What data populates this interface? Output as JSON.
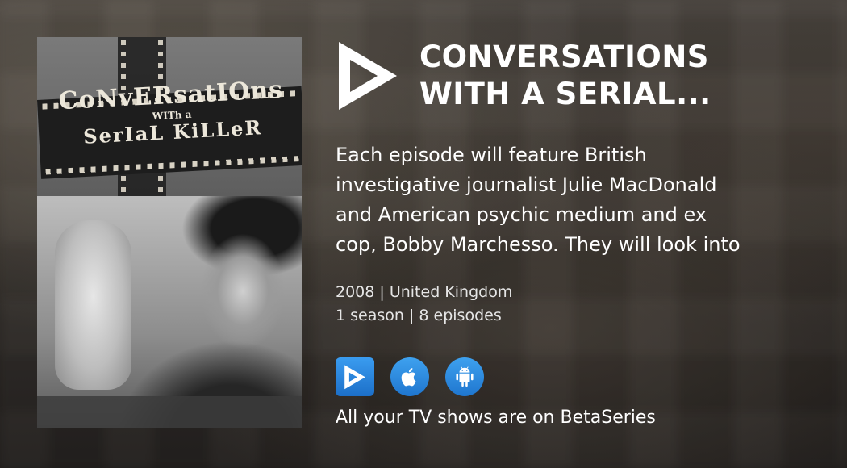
{
  "show": {
    "title_line1": "CONVERSATIONS",
    "title_line2": "WITH A SERIAL...",
    "description_lines": [
      "Each episode will feature British",
      "investigative journalist Julie MacDonald",
      "and American psychic medium and ex",
      "cop, Bobby Marchesso. They will look into"
    ],
    "year_country": "2008 | United Kingdom",
    "seasons_episodes": "1 season | 8 episodes"
  },
  "poster": {
    "title_line1": "CoNvERsatIOns",
    "title_line2": "WITh a",
    "title_line3": "SerIaL KiLLeR"
  },
  "stores": [
    {
      "name": "betaseries-app",
      "icon": "betaseries-icon"
    },
    {
      "name": "app-store",
      "icon": "apple-icon"
    },
    {
      "name": "google-play",
      "icon": "android-icon"
    }
  ],
  "footer": {
    "text": "All your TV shows are on BetaSeries"
  },
  "colors": {
    "accent": "#2a86de",
    "text": "#ffffff"
  }
}
